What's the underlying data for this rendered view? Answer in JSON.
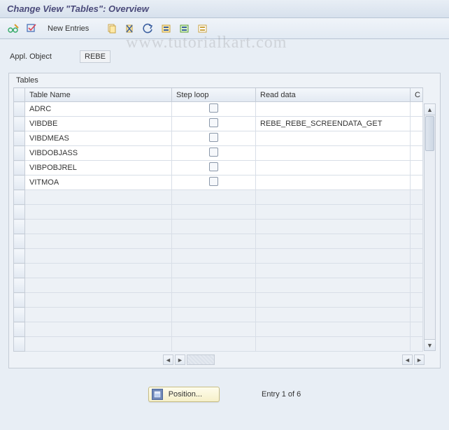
{
  "title": "Change View \"Tables\": Overview",
  "watermark": "www.tutorialkart.com",
  "toolbar": {
    "new_entries_label": "New Entries"
  },
  "field": {
    "label": "Appl. Object",
    "value": "REBE"
  },
  "panel": {
    "title": "Tables"
  },
  "columns": {
    "name": "Table Name",
    "step": "Step loop",
    "read": "Read data",
    "c": "C"
  },
  "rows": [
    {
      "name": "ADRC",
      "step": false,
      "read": ""
    },
    {
      "name": "VIBDBE",
      "step": false,
      "read": "REBE_REBE_SCREENDATA_GET"
    },
    {
      "name": "VIBDMEAS",
      "step": false,
      "read": ""
    },
    {
      "name": "VIBDOBJASS",
      "step": false,
      "read": ""
    },
    {
      "name": "VIBPOBJREL",
      "step": false,
      "read": ""
    },
    {
      "name": "VITMOA",
      "step": false,
      "read": ""
    }
  ],
  "empty_rows": 11,
  "footer": {
    "position_label": "Position...",
    "entry_text": "Entry 1 of 6"
  }
}
